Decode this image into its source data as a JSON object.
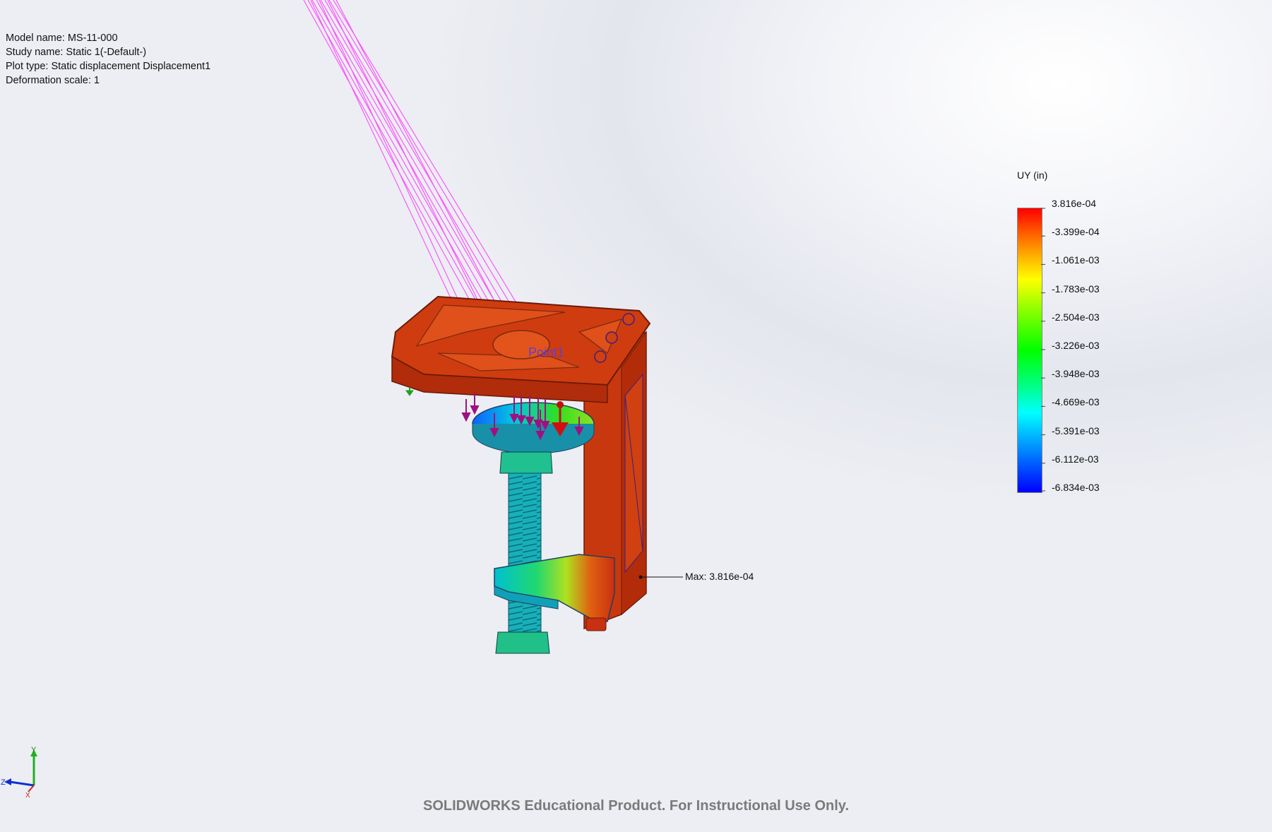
{
  "info": {
    "model_name": "Model name: MS-11-000",
    "study_name": "Study name: Static 1(-Default-)",
    "plot_type": "Plot type: Static displacement Displacement1",
    "deformation_scale": "Deformation scale: 1"
  },
  "legend": {
    "title": "UY (in)",
    "values": [
      "3.816e-04",
      "-3.399e-04",
      "-1.061e-03",
      "-1.783e-03",
      "-2.504e-03",
      "-3.226e-03",
      "-3.948e-03",
      "-4.669e-03",
      "-5.391e-03",
      "-6.112e-03",
      "-6.834e-03"
    ],
    "colors": {
      "max": "#ff0000",
      "min": "#0000ff"
    }
  },
  "probe": {
    "max_label": "Max: 3.816e-04"
  },
  "part_label": "Point1",
  "triad": {
    "x": "X",
    "y": "Y",
    "z": "Z"
  },
  "watermark": "SOLIDWORKS Educational Product. For Instructional Use Only.",
  "colors": {
    "part_red": "#d33a10",
    "force_arrow": "#a01080",
    "ray": "#ff30ff"
  }
}
